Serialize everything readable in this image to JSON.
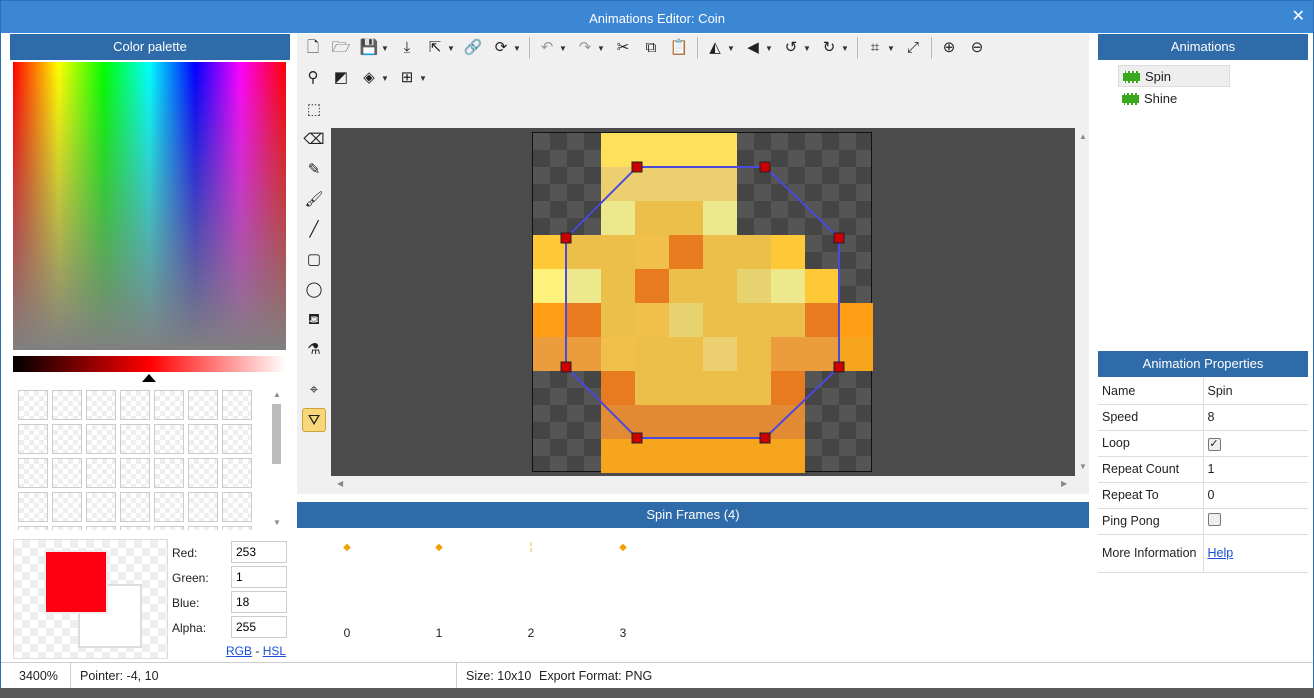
{
  "window": {
    "title": "Animations Editor: Coin",
    "close_glyph": "✕"
  },
  "palette": {
    "title": "Color palette",
    "primary_color": "#fd0112",
    "secondary_color": "#ffffff",
    "fields": [
      {
        "label": "Red:",
        "value": "253"
      },
      {
        "label": "Green:",
        "value": "1"
      },
      {
        "label": "Blue:",
        "value": "18"
      },
      {
        "label": "Alpha:",
        "value": "255"
      }
    ],
    "mode_rgb": "RGB",
    "mode_sep": " - ",
    "mode_hsl": "HSL"
  },
  "toolbar": {
    "row1": [
      "new-icon",
      "open-icon",
      "save-icon",
      "import-icon",
      "export-icon",
      "link-icon",
      "refresh-icon",
      "undo-icon",
      "redo-icon",
      "cut-icon",
      "copy-icon",
      "paste-icon",
      "mirror-icon",
      "flip-icon",
      "rotate-ccw-icon",
      "rotate-cw-icon",
      "crop-icon",
      "resize-icon",
      "zoom-in-icon",
      "zoom-out-icon"
    ],
    "row2": [
      "search-icon",
      "invert-icon",
      "layers-icon",
      "grid-icon"
    ]
  },
  "tools": [
    "select-rect-icon",
    "eraser-icon",
    "pencil-icon",
    "brush-icon",
    "line-icon",
    "rectangle-icon",
    "ellipse-icon",
    "fill-icon",
    "picker-icon",
    "origin-icon",
    "collision-poly-icon"
  ],
  "pixels": {
    "colors": {
      "a": "#ffe05a",
      "b": "#ecd070",
      "c": "#ecbe4a",
      "d": "#eee88c",
      "e": "#ffc837",
      "f": "#ff9e14",
      "g": "#fff27c",
      "h": "#e87a20",
      "i": "#e6d370",
      "j": "#f0c04b",
      "k": "#e38a34",
      "l": "#f8a51e",
      "m": "#eb9c3c"
    }
  },
  "frames": {
    "title": "Spin Frames (4)",
    "items": [
      "0",
      "1",
      "2",
      "3"
    ]
  },
  "animations": {
    "title": "Animations",
    "items": [
      "Spin",
      "Shine"
    ],
    "selected": 0
  },
  "properties": {
    "title": "Animation Properties",
    "rows": [
      {
        "key": "Name",
        "value": "Spin"
      },
      {
        "key": "Speed",
        "value": "8"
      },
      {
        "key": "Loop",
        "value": "✓"
      },
      {
        "key": "Repeat Count",
        "value": "1"
      },
      {
        "key": "Repeat To",
        "value": "0"
      },
      {
        "key": "Ping Pong",
        "value": ""
      },
      {
        "key": "More Information",
        "value": "Help"
      }
    ]
  },
  "status": {
    "zoom": "3400%",
    "pointer": "Pointer: -4, 10",
    "size": "Size: 10x10",
    "export": "Export Format: PNG"
  }
}
